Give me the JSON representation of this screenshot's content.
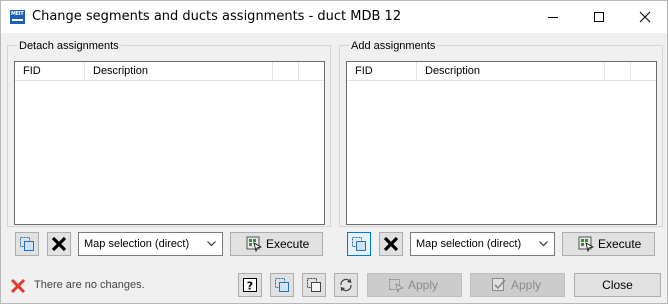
{
  "window": {
    "title": "Change segments and ducts assignments - duct MDB 12",
    "logo_text": "MEIT",
    "controls": [
      "minimize-icon",
      "maximize-icon",
      "close-icon"
    ]
  },
  "detach": {
    "title": "Detach assignments",
    "columns": [
      "FID",
      "Description"
    ],
    "rows": [],
    "map_selection": "Map selection (direct)",
    "execute_label": "Execute"
  },
  "add": {
    "title": "Add assignments",
    "columns": [
      "FID",
      "Description"
    ],
    "rows": [],
    "map_selection": "Map selection (direct)",
    "execute_label": "Execute"
  },
  "status": {
    "text": "There are no changes.",
    "icon": "red-x-icon"
  },
  "footer": {
    "apply1_label": "Apply",
    "apply2_label": "Apply",
    "close_label": "Close",
    "icons": [
      "help-icon",
      "select-copy-icon",
      "select-icon",
      "refresh-icon"
    ]
  },
  "colors": {
    "accent": "#0078d7",
    "logo": "#1f5fb0",
    "error": "#e23a2e",
    "disabled_bg": "#cccccc"
  }
}
